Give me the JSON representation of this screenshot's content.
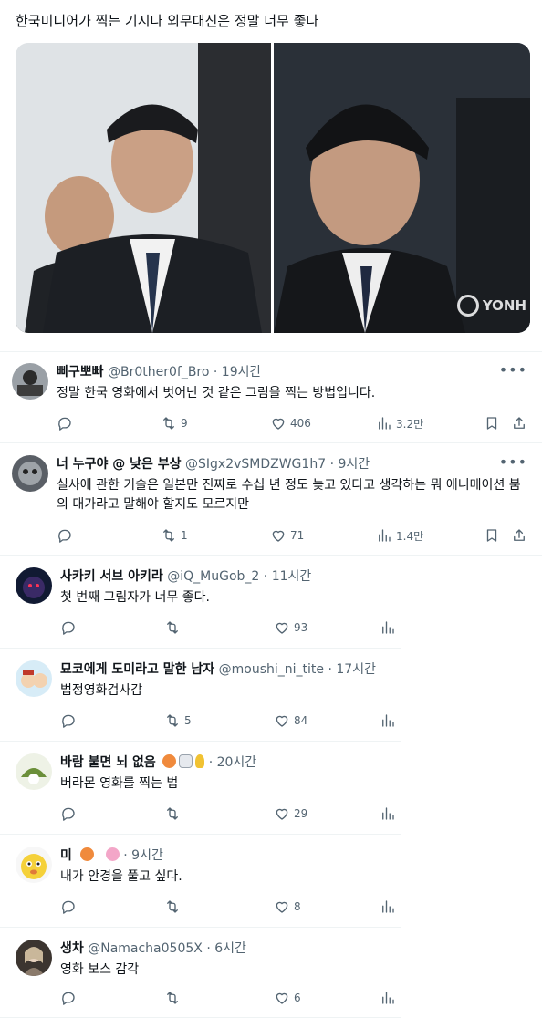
{
  "post": {
    "text": "한국미디어가 찍는 기시다 외무대신은 정말 너무 좋다",
    "watermark": "YONH"
  },
  "replies": [
    {
      "name": "삐구뽀빠",
      "handle": "@Br0ther0f_Bro",
      "dot": "·",
      "time": "19시간",
      "text": "정말 한국 영화에서 벗어난 것 같은 그림을 찍는 방법입니다.",
      "reposts": "9",
      "likes": "406",
      "views": "3.2만"
    },
    {
      "name": "너 누구야 @ 낮은 부상",
      "handle": "@SIgx2vSMDZWG1h7",
      "dot": "·",
      "time": "9시간",
      "text": "실사에 관한 기술은 일본만 진짜로 수십 년 정도 늦고 있다고 생각하는 뭐 애니메이션 붐의 대가라고 말해야 할지도 모르지만",
      "reposts": "1",
      "likes": "71",
      "views": "1.4만"
    },
    {
      "name": "사카키 서브 아키라",
      "handle": "@iQ_MuGob_2",
      "dot": "·",
      "time": "11시간",
      "text": "첫 번째 그림자가 너무 좋다.",
      "reposts": "",
      "likes": "93"
    },
    {
      "name": "묘코에게 도미라고 말한 남자",
      "handle": "@moushi_ni_tite",
      "dot": "·",
      "time": "17시간",
      "text": "법정영화검사감",
      "reposts": "5",
      "likes": "84"
    },
    {
      "name": "바람 불면 뇌 없음",
      "handle": "",
      "dot": "·",
      "time": "20시간",
      "text": "버라몬 영화를 찍는 법",
      "reposts": "",
      "likes": "29"
    },
    {
      "name": "미",
      "handle": "",
      "dot": "·",
      "time": "9시간",
      "text": "내가 안경을 풀고 싶다.",
      "reposts": "",
      "likes": "8"
    },
    {
      "name": "생차",
      "handle": "@Namacha0505X",
      "dot": "·",
      "time": "6시간",
      "text": "영화 보스 감각",
      "reposts": "",
      "likes": "6"
    }
  ],
  "icons": {
    "reply": "speech-bubble-icon",
    "repost": "repost-arrows-icon",
    "like": "heart-icon",
    "views": "bar-chart-icon",
    "bookmark": "bookmark-icon",
    "share": "share-icon",
    "more": "more-dots-icon"
  },
  "colors": {
    "text": "#0f1419",
    "muted": "#536471",
    "divider": "#eff3f4"
  }
}
